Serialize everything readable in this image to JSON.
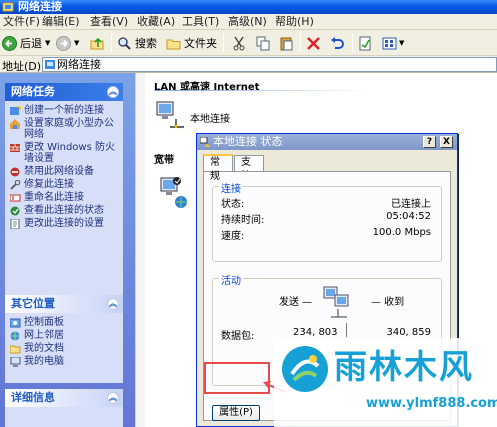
{
  "window": {
    "title": "网络连接"
  },
  "menu": [
    "文件(F)",
    "编辑(E)",
    "查看(V)",
    "收藏(A)",
    "工具(T)",
    "高级(N)",
    "帮助(H)"
  ],
  "toolbar": {
    "back": "后退",
    "search": "搜索",
    "folders": "文件夹"
  },
  "address": {
    "label": "地址(D)",
    "value": "网络连接"
  },
  "left": {
    "network_tasks": {
      "title": "网络任务",
      "items": [
        "创建一个新的连接",
        "设置家庭或小型办公网络",
        "更改 Windows 防火墙设置",
        "禁用此网络设备",
        "修复此连接",
        "重命名此连接",
        "查看此连接的状态",
        "更改此连接的设置"
      ]
    },
    "other_places": {
      "title": "其它位置",
      "items": [
        "控制面板",
        "网上邻居",
        "我的文档",
        "我的电脑"
      ]
    },
    "details": {
      "title": "详细信息"
    }
  },
  "main": {
    "section_lan": "LAN 或高速 Internet",
    "local_conn": "本地连接",
    "section_broadband": "宽带"
  },
  "dialog": {
    "title": "本地连接 状态",
    "help": "?",
    "close": "X",
    "tabs": [
      "常规",
      "支持"
    ],
    "connection": {
      "title": "连接",
      "rows": [
        {
          "label": "状态:",
          "value": "已连接上"
        },
        {
          "label": "持续时间:",
          "value": "05:04:52"
        },
        {
          "label": "速度:",
          "value": "100.0 Mbps"
        }
      ]
    },
    "activity": {
      "title": "活动",
      "sent": "发送 —",
      "received": "— 收到",
      "packets_label": "数据包:",
      "sent_value": "234, 803",
      "received_value": "340, 859"
    },
    "properties_button": "属性(P)"
  },
  "watermark": {
    "name": "雨林木风",
    "url": "www.ylmf888.com"
  },
  "colors": {
    "xp_blue": "#0a5be8",
    "task_blue": "#215dc6",
    "highlight_red": "#e64a4a",
    "watermark": "#16a0d6"
  }
}
